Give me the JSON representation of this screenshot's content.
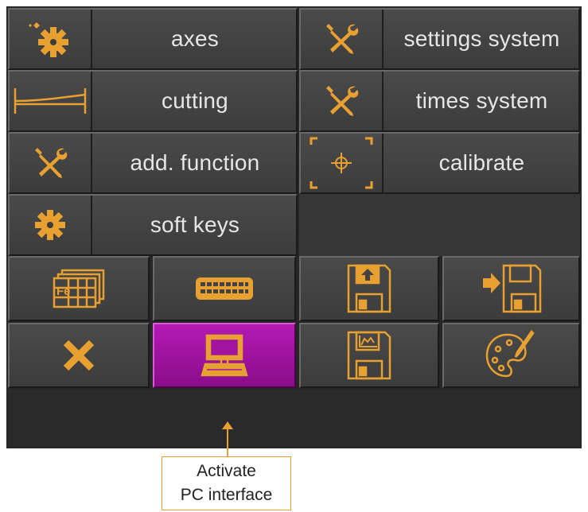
{
  "menu": {
    "items": [
      {
        "id": "axes",
        "label": "axes",
        "icon": "gear-sparkle-icon"
      },
      {
        "id": "settings-system",
        "label": "settings system",
        "icon": "wrench-screwdriver-icon"
      },
      {
        "id": "cutting",
        "label": "cutting",
        "icon": "cutting-profile-icon"
      },
      {
        "id": "times-system",
        "label": "times system",
        "icon": "wrench-screwdriver-icon"
      },
      {
        "id": "add-function",
        "label": "add. function",
        "icon": "wrench-screwdriver-icon"
      },
      {
        "id": "calibrate",
        "label": "calibrate",
        "icon": "crosshair-icon"
      },
      {
        "id": "soft-keys",
        "label": "soft keys",
        "icon": "gear-icon"
      }
    ]
  },
  "toolbar": {
    "row1": [
      {
        "id": "material-table",
        "icon": "material-table-icon",
        "text": "Fe"
      },
      {
        "id": "keyboard",
        "icon": "keyboard-icon"
      },
      {
        "id": "save-upload",
        "icon": "floppy-upload-icon"
      },
      {
        "id": "save-import",
        "icon": "floppy-import-icon"
      }
    ],
    "row2": [
      {
        "id": "close",
        "icon": "close-icon"
      },
      {
        "id": "pc-interface",
        "icon": "computer-icon",
        "active": true
      },
      {
        "id": "save-chart",
        "icon": "floppy-chart-icon"
      },
      {
        "id": "palette",
        "icon": "palette-icon"
      }
    ]
  },
  "callout": {
    "line1": "Activate",
    "line2": "PC interface"
  },
  "colors": {
    "accent": "#E8A030",
    "active": "#A014A0",
    "button": "#434343",
    "panel": "#262626"
  }
}
